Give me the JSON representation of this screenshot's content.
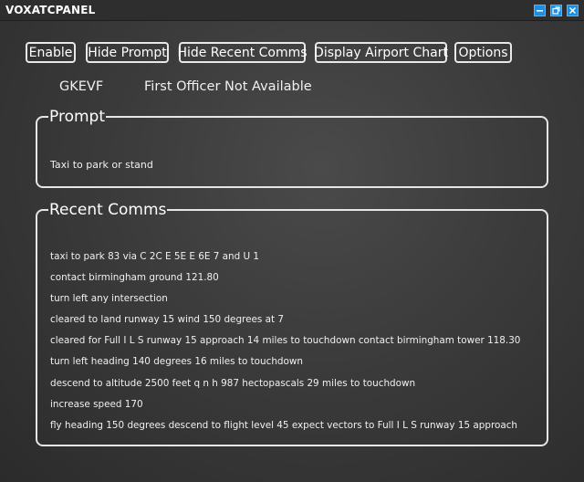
{
  "window": {
    "title": "VOXATCPANEL"
  },
  "toolbar": {
    "buttons": [
      {
        "label": "Enable"
      },
      {
        "label": "Hide Prompt"
      },
      {
        "label": "Hide Recent Comms"
      },
      {
        "label": "Display Airport Chart"
      },
      {
        "label": "Options"
      }
    ]
  },
  "info": {
    "callsign": "GKEVF",
    "first_officer_status": "First Officer Not Available"
  },
  "prompt": {
    "heading": "Prompt",
    "text": "Taxi to park or stand"
  },
  "recent_comms": {
    "heading": "Recent Comms",
    "items": [
      "taxi to park 83 via C 2C E 5E E 6E 7 and U 1",
      "contact birmingham ground 121.80",
      "turn left any intersection",
      "cleared to land runway 15 wind 150 degrees at 7",
      "cleared for Full I L S runway 15 approach 14 miles to touchdown contact birmingham tower 118.30",
      "turn left heading 140 degrees 16 miles to touchdown",
      "descend to altitude 2500 feet q n h 987 hectopascals 29 miles to touchdown",
      "increase speed 170",
      "fly heading 150 degrees descend to flight level 45 expect vectors to Full I L S runway 15 approach"
    ]
  },
  "colors": {
    "titlebar_button": "#1e8fe0",
    "background": "#3b3b3b",
    "border": "#e6e6e6"
  },
  "icons": [
    "minimize-icon",
    "maximize-icon",
    "close-icon"
  ]
}
